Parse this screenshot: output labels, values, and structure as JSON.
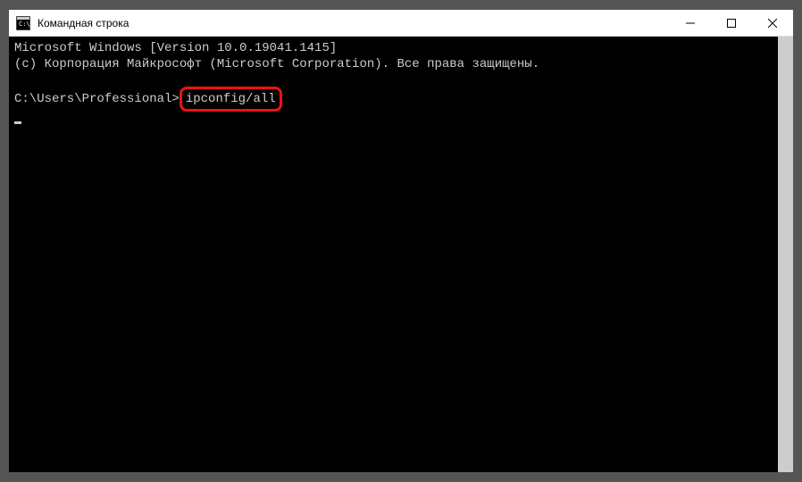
{
  "titlebar": {
    "title": "Командная строка"
  },
  "terminal": {
    "line1": "Microsoft Windows [Version 10.0.19041.1415]",
    "line2": "(c) Корпорация Майкрософт (Microsoft Corporation). Все права защищены.",
    "prompt_path": "C:\\Users\\Professional>",
    "command": "ipconfig/all"
  }
}
